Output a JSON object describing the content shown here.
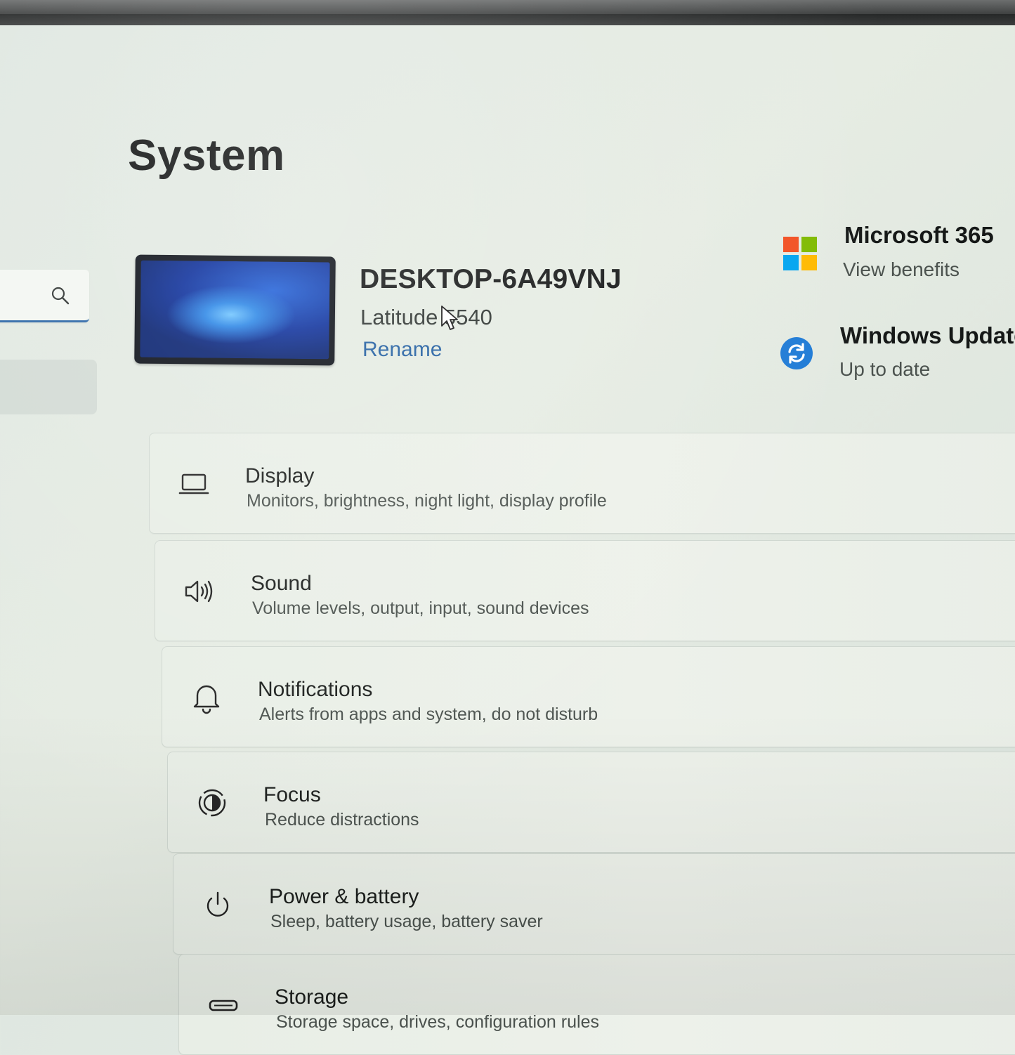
{
  "page": {
    "title": "System"
  },
  "device": {
    "name": "DESKTOP-6A49VNJ",
    "model": "Latitude 5540",
    "rename_label": "Rename"
  },
  "info_panels": {
    "microsoft365": {
      "title": "Microsoft 365",
      "subtitle": "View benefits",
      "logo_colors": [
        "#f25022",
        "#7fba00",
        "#00a4ef",
        "#ffb900"
      ]
    },
    "windows_update": {
      "title": "Windows Update",
      "subtitle": "Up to date",
      "icon": "sync-icon",
      "color": "#1f7bd6"
    }
  },
  "sidebar": {
    "search_icon": "search-icon",
    "accent_color": "#2b66a6"
  },
  "settings": [
    {
      "id": "display",
      "title": "Display",
      "subtitle": "Monitors, brightness, night light, display profile",
      "icon": "laptop-icon"
    },
    {
      "id": "sound",
      "title": "Sound",
      "subtitle": "Volume levels, output, input, sound devices",
      "icon": "speaker-icon"
    },
    {
      "id": "notifications",
      "title": "Notifications",
      "subtitle": "Alerts from apps and system, do not disturb",
      "icon": "bell-icon"
    },
    {
      "id": "focus",
      "title": "Focus",
      "subtitle": "Reduce distractions",
      "icon": "focus-icon"
    },
    {
      "id": "power",
      "title": "Power & battery",
      "subtitle": "Sleep, battery usage, battery saver",
      "icon": "power-icon"
    },
    {
      "id": "storage",
      "title": "Storage",
      "subtitle": "Storage space, drives, configuration rules",
      "icon": "storage-icon"
    }
  ]
}
